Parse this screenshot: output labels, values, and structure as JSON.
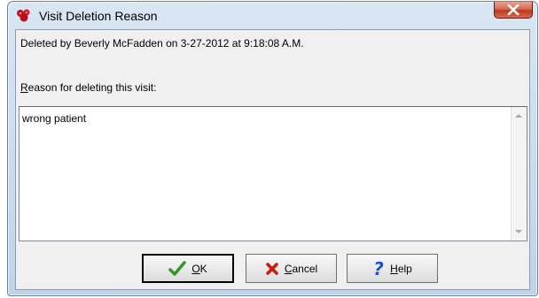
{
  "window": {
    "title": "Visit Deletion Reason"
  },
  "info": {
    "deleted_by": "Deleted by Beverly McFadden on 3-27-2012 at 9:18:08 A.M."
  },
  "reason": {
    "label_accel": "R",
    "label_rest": "eason for deleting this visit:",
    "value": "wrong patient"
  },
  "buttons": {
    "ok": {
      "accel": "O",
      "rest": "K",
      "icon": "checkmark-icon"
    },
    "cancel": {
      "accel": "C",
      "rest": "ancel",
      "icon": "x-icon"
    },
    "help": {
      "accel": "H",
      "rest": "elp",
      "icon": "question-icon"
    }
  },
  "colors": {
    "ok_check": "#2e9a1f",
    "cancel_x": "#c81e12",
    "help_q": "#1f4fcf",
    "close_red": "#c0381e"
  }
}
